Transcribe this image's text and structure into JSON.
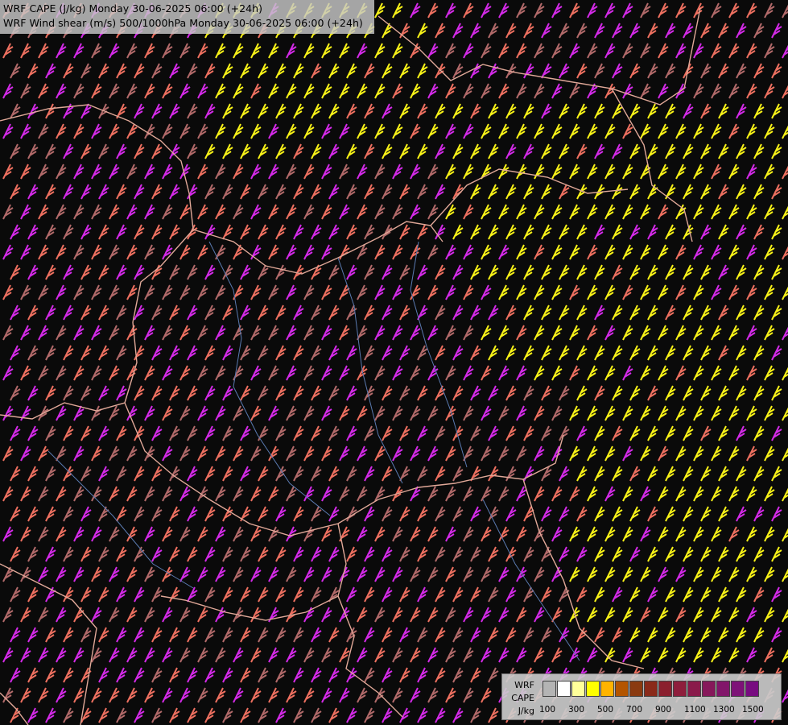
{
  "titles": {
    "line1": "WRF CAPE (J/kg) Monday 30-06-2025 06:00 (+24h)",
    "line2": "WRF Wind shear (m/s) 500/1000hPa Monday 30-06-2025 06:00 (+24h)"
  },
  "legend": {
    "label_line1": "WRF",
    "label_line2": "CAPE",
    "label_line3": "J/kg",
    "swatch_colors": [
      "#b4b4b4",
      "#ffffff",
      "#ffff9a",
      "#ffff00",
      "#ffb300",
      "#b45500",
      "#8a3a10",
      "#8a2a1a",
      "#8b1f2e",
      "#8e1e3c",
      "#8a1a4a",
      "#86185a",
      "#82166a",
      "#7e1278",
      "#780c80"
    ],
    "tick_labels": [
      "100",
      "300",
      "500",
      "700",
      "900",
      "1100",
      "1300",
      "1500"
    ]
  },
  "barb_colors": {
    "magenta": "#d42ae8",
    "salmon": "#ee7060",
    "brown": "#b26a6a",
    "yellow": "#f8f218",
    "olive": "#a8a030"
  },
  "map_colors": {
    "background": "#0a0a0a",
    "border": "#e0a898",
    "river": "#5a7ab0",
    "terrain": "#8a8a8a"
  }
}
